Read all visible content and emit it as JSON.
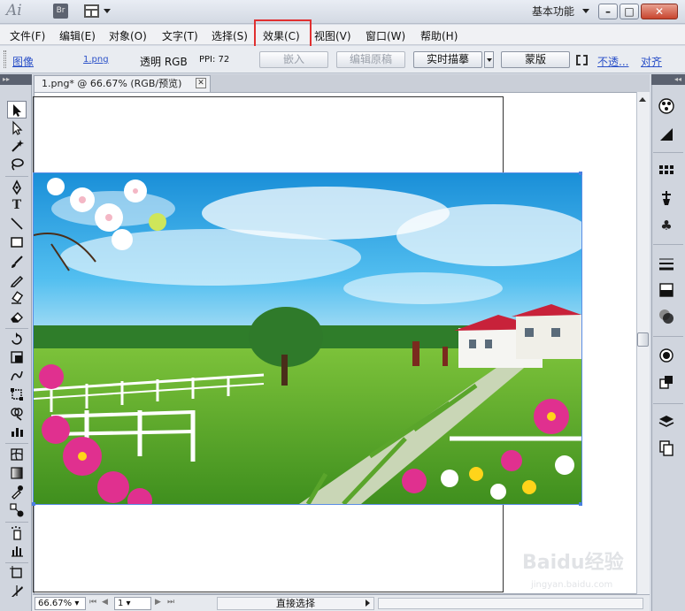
{
  "titlebar": {
    "app_logo": "Ai",
    "bridge_label": "Br",
    "workspace_label": "基本功能",
    "window_buttons": [
      "–",
      "□",
      "✕"
    ]
  },
  "menubar": {
    "items": [
      "文件(F)",
      "编辑(E)",
      "对象(O)",
      "文字(T)",
      "选择(S)",
      "效果(C)",
      "视图(V)",
      "窗口(W)",
      "帮助(H)"
    ]
  },
  "controlbar": {
    "type_label": "图像",
    "file_name": "1.png",
    "color_mode": "透明 RGB",
    "ppi": "PPI: 72",
    "embed_button": "嵌入",
    "edit_original_button": "编辑原稿",
    "live_trace_button": "实时描摹",
    "mask_button": "蒙版",
    "opacity_link": "不透...",
    "align_link": "对齐"
  },
  "document": {
    "tab_title": "1.png* @ 66.67% (RGB/预览)",
    "tab_close": "✕"
  },
  "statusbar": {
    "zoom": "66.67%",
    "page": "1",
    "current_tool": "直接选择"
  },
  "watermark": {
    "logo_text": "Baidu经验",
    "sub_text": "jingyan.baidu.com"
  },
  "colors": {
    "highlight_red": "#e03030",
    "link_blue": "#2a50c8",
    "selection_blue": "#5a8de6"
  }
}
